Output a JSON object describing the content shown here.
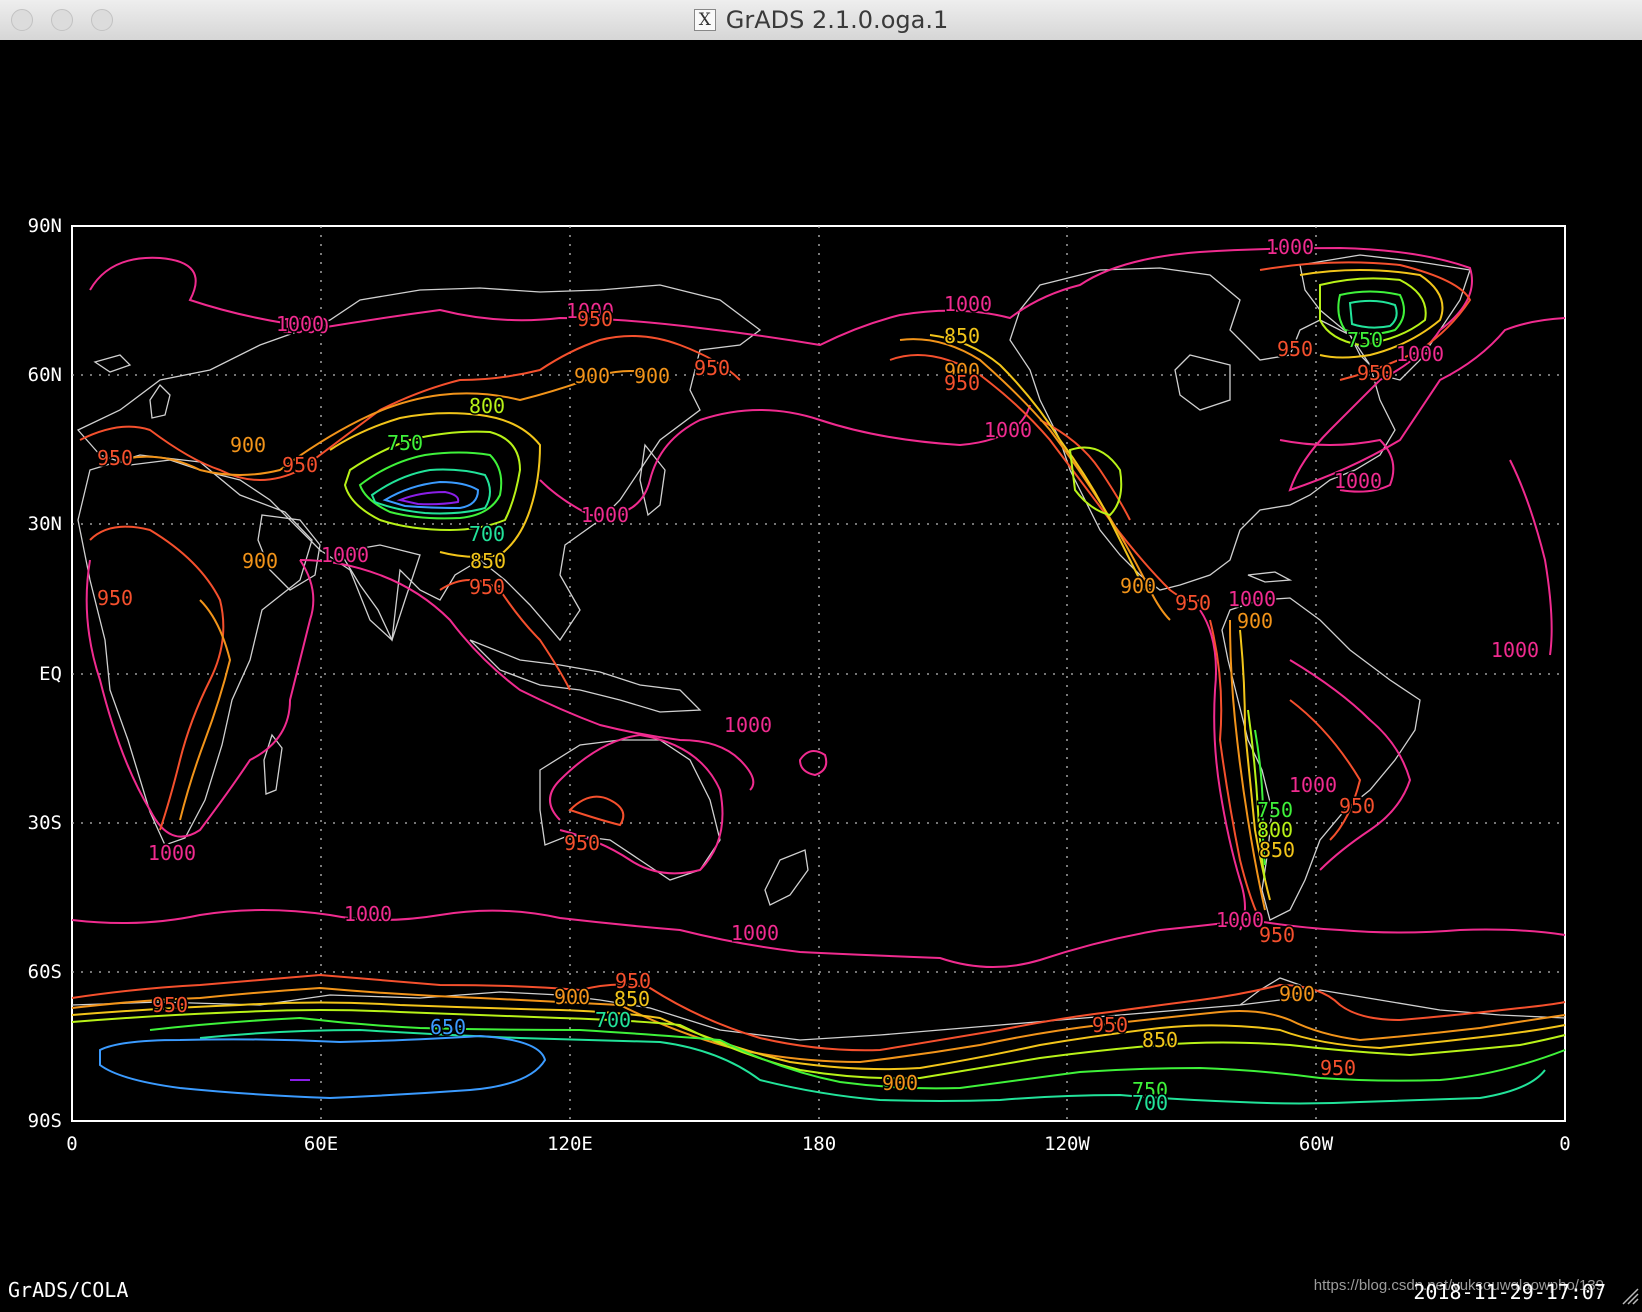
{
  "window": {
    "title": "GrADS 2.1.0.oga.1"
  },
  "plot": {
    "lat_labels": [
      "90N",
      "60N",
      "30N",
      "EQ",
      "30S",
      "60S",
      "90S"
    ],
    "lon_labels": [
      "0",
      "60E",
      "120E",
      "180",
      "120W",
      "60W",
      "0"
    ],
    "contour_levels": [
      650,
      700,
      750,
      800,
      850,
      900,
      950,
      1000
    ],
    "level_colors": {
      "600": "#8a1ee8",
      "650": "#3b9bff",
      "700": "#22e39a",
      "750": "#3ff23a",
      "800": "#b8f218",
      "850": "#f2c51a",
      "900": "#f2941a",
      "950": "#f5502d",
      "1000": "#f02b8f"
    },
    "contour_labels": [
      {
        "text": "1000"
      },
      {
        "text": "950"
      },
      {
        "text": "1000"
      },
      {
        "text": "950"
      },
      {
        "text": "900"
      },
      {
        "text": "950"
      },
      {
        "text": "750"
      },
      {
        "text": "800"
      },
      {
        "text": "900"
      },
      {
        "text": "900"
      },
      {
        "text": "950"
      },
      {
        "text": "1000"
      },
      {
        "text": "700"
      },
      {
        "text": "850"
      },
      {
        "text": "950"
      },
      {
        "text": "1000"
      },
      {
        "text": "900"
      },
      {
        "text": "950"
      },
      {
        "text": "1000"
      },
      {
        "text": "850"
      },
      {
        "text": "900"
      },
      {
        "text": "950"
      },
      {
        "text": "1000"
      },
      {
        "text": "1000"
      },
      {
        "text": "750"
      },
      {
        "text": "950"
      },
      {
        "text": "1000"
      },
      {
        "text": "950"
      },
      {
        "text": "1000"
      },
      {
        "text": "900"
      },
      {
        "text": "950"
      },
      {
        "text": "1000"
      },
      {
        "text": "900"
      },
      {
        "text": "1000"
      },
      {
        "text": "1000"
      },
      {
        "text": "750"
      },
      {
        "text": "800"
      },
      {
        "text": "850"
      },
      {
        "text": "950"
      },
      {
        "text": "1000"
      },
      {
        "text": "1000"
      },
      {
        "text": "950"
      },
      {
        "text": "1000"
      },
      {
        "text": "950"
      },
      {
        "text": "1000"
      },
      {
        "text": "1000"
      },
      {
        "text": "1000"
      },
      {
        "text": "950"
      },
      {
        "text": "650"
      },
      {
        "text": "900"
      },
      {
        "text": "850"
      },
      {
        "text": "950"
      },
      {
        "text": "700"
      },
      {
        "text": "900"
      },
      {
        "text": "950"
      },
      {
        "text": "850"
      },
      {
        "text": "900"
      },
      {
        "text": "950"
      },
      {
        "text": "750"
      },
      {
        "text": "700"
      }
    ]
  },
  "footer": {
    "left_label": "GrADS/COLA",
    "datestamp": "2018-11-29-17:07",
    "watermark": "https://blog.csdn.net/yuksouwqlaowpho/139"
  }
}
